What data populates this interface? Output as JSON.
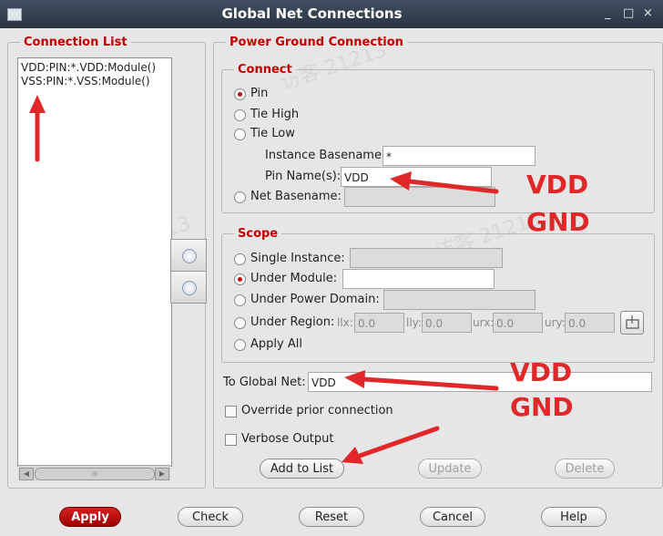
{
  "window": {
    "title": "Global Net Connections",
    "controls": [
      "_",
      "□",
      "×"
    ]
  },
  "connection_list": {
    "legend": "Connection List",
    "items": [
      "VDD:PIN:*.VDD:Module()",
      "VSS:PIN:*.VSS:Module()"
    ],
    "scroll_thumb": "III"
  },
  "power_ground": {
    "legend": "Power Ground Connection",
    "connect": {
      "legend": "Connect",
      "pin_label": "Pin",
      "tie_high_label": "Tie High",
      "tie_low_label": "Tie Low",
      "instance_basename_label": "Instance Basename:",
      "instance_basename_value": "*",
      "pin_names_label": "Pin Name(s):",
      "pin_names_value": "VDD",
      "net_basename_label": "Net Basename:",
      "net_basename_value": "",
      "selected": "Pin"
    },
    "scope": {
      "legend": "Scope",
      "single_instance_label": "Single Instance:",
      "under_module_label": "Under Module:",
      "under_power_domain_label": "Under Power Domain:",
      "under_region_label": "Under Region:",
      "llx_label": "llx:",
      "llx_value": "0.0",
      "lly_label": "lly:",
      "lly_value": "0.0",
      "urx_label": "urx:",
      "urx_value": "0.0",
      "ury_label": "ury:",
      "ury_value": "0.0",
      "apply_all_label": "Apply All",
      "selected": "Under Module"
    },
    "to_global_net_label": "To Global Net:",
    "to_global_net_value": "VDD",
    "override_label": "Override prior connection",
    "verbose_label": "Verbose Output",
    "add_to_list_label": "Add to List",
    "update_label": "Update",
    "delete_label": "Delete"
  },
  "bottom_buttons": {
    "apply": "Apply",
    "check": "Check",
    "reset": "Reset",
    "cancel": "Cancel",
    "help": "Help"
  },
  "annotations": {
    "pin_names_note": [
      "VDD",
      "GND"
    ],
    "global_net_note": [
      "VDD",
      "GND"
    ],
    "color": "#e0282a"
  },
  "watermark": "访客 21213",
  "colors": {
    "legend": "#c00000",
    "titlebar": "#2f3b4a",
    "apply_button": "#c00000"
  }
}
